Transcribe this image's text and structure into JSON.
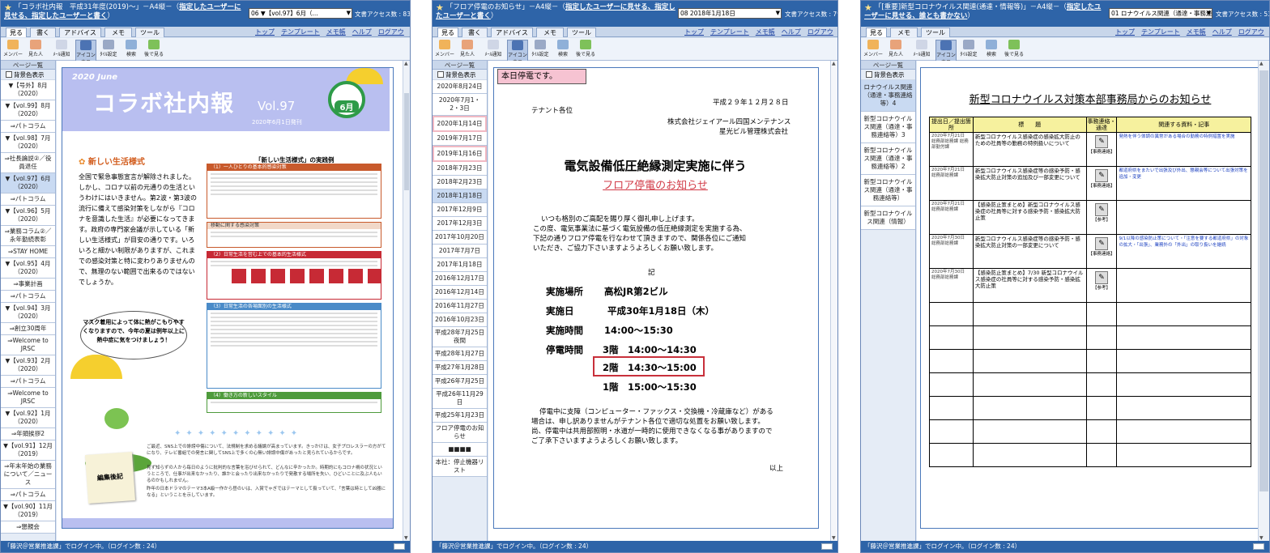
{
  "windows": [
    {
      "title": "「コラボ社内報　平成31年度(2019)～」－A4縦－（",
      "title_link": "指定したユーザーに見せる、指定したユーザーと書く",
      "title_end": "）",
      "select": "06 ▼【vol.97】6月（...",
      "access": "文書アクセス数 : 839",
      "tabs": [
        "見る",
        "書く",
        "アドバイス",
        "メモ",
        "ツール"
      ],
      "links": [
        "トップ",
        "テンプレート",
        "メモ帳",
        "ヘルプ",
        "ログアウト"
      ],
      "tools": [
        "メンバー",
        "見た人",
        "ﾒｰﾙ通知",
        "アイコン表示",
        "ﾀｲﾙ設定",
        "検索",
        "後で見る"
      ],
      "sidebar_header": "ページ一覧",
      "sidebar_check": "背景色表示",
      "sidebar_items": [
        "▼【号外】8月（2020）",
        "▼【vol.99】8月（2020）",
        "⇒パトコラム",
        "▼【vol.98】7月（2020）",
        "⇒社長論説②／役員退任",
        "▼【vol.97】6月（2020）",
        "⇒パトコラム",
        "▼【vol.96】5月（2020）",
        "⇒業務コラム②／永年勤続表彰",
        "⇒STAY HOME",
        "▼【vol.95】4月（2020）",
        "⇒事業計画",
        "⇒パトコラム",
        "▼【vol.94】3月（2020）",
        "⇒創立30周年",
        "⇒Welcome to JRSC",
        "▼【vol.93】2月（2020）",
        "⇒パトコラム",
        "⇒Welcome to JRSC",
        "▼【vol.92】1月（2020）",
        "⇒年頭挨拶2",
        "▼【vol.91】12月（2019）",
        "⇒年末年始の業務について／ニュース",
        "⇒パトコラム",
        "▼【vol.90】11月（2019）",
        "⇒懇親会"
      ],
      "newsletter": {
        "year": "2020 June",
        "title": "コラボ社内報",
        "vol": "Vol.97",
        "date": "2020年6月1日発刊",
        "month": "6月",
        "section": "新しい生活様式",
        "body": "全国で緊急事態宣言が解除されました。しかし、コロナ以前の元通りの生活というわけにはいきません。第2波・第3波の流行に備えて感染対策をしながら『コロナを意識した生活』が必要になってきます。政府の専門家会議が示している「新しい生活様式」が目安の通りです。いろいろと細かい制限がありますが、これまでの感染対策と特に変わりありませんので、無理のない範囲で出来るのではないでしょうか。",
        "right_title": "「新しい生活様式」の実践例",
        "box1": "（1）一人ひとりの基本的感染対策",
        "box2": "移動に関する感染対策",
        "box3": "（2）日常生活を営む上での基本的生活様式",
        "box4": "（3）日常生活の各場面別の生活様式",
        "box5": "（4）働き方の新しいスタイル",
        "bubble": "マスク着用によって体に熱がこもりやすくなりますので、今年の夏は例年以上に熱中症に気をつけましょう！",
        "note": "編集後記",
        "para1": "ご最近、SNS上での誹謗中傷について、法規制を求める議論が高まっています。きっかけは、女子プロレスラーの方がてになり、テレビ番組での発言に関してSNS上で多くの心無い誹謗中傷があったと見られているからです。",
        "para2": "見ず知らずの人から毎日のように批判的な言葉を浴びせられて、どんなに辛かったか。時期的にもコロナ禍の状況というところで、仕事が出来なかったり、誰かと会ったり出来なかったりで発散する場所を失い、ひどいことに及ぶ人もいるのかもしれません。",
        "para3": "昨年の日本ドラマのテーマ3本A級一作から昼のいは、入賞でゃぎではテーマとして扱っていて、「言葉は時として凶器になる」ということを示しています。"
      },
      "status": "「藤沢＠営業推進課」でログイン中。（ログイン数 : 24）"
    },
    {
      "title": "「フロア停電のお知らせ」－A4縦－（",
      "title_link": "指定したユーザーに見せる、指定したユーザーと書く",
      "title_end": "）",
      "select": "08 2018年1月18日",
      "access": "文書アクセス数 : 797",
      "tabs": [
        "見る",
        "書く",
        "アドバイス",
        "メモ",
        "ツール"
      ],
      "links": [
        "トップ",
        "テンプレート",
        "メモ帳",
        "ヘルプ",
        "ログアウト"
      ],
      "tools": [
        "メンバー",
        "見た人",
        "ﾒｰﾙ通知",
        "アイコン表示",
        "ﾀｲﾙ設定",
        "検索",
        "後で見る"
      ],
      "sidebar_header": "ページ一覧",
      "sidebar_check": "背景色表示",
      "sidebar_items": [
        "2020年8月24日",
        "2020年7月1・2・3日",
        "2020年1月14日",
        "2019年7月17日",
        "2019年1月16日",
        "2018年7月23日",
        "2018年2月23日",
        "2018年1月18日",
        "2017年12月9日",
        "2017年12月3日",
        "2017年10月20日",
        "2017年7月7日",
        "2017年1月18日",
        "2016年12月17日",
        "2016年12月14日",
        "2016年11月27日",
        "2016年10月23日",
        "平成28年7月25日夜間",
        "平成28年1月27日",
        "平成27年1月28日",
        "平成26年7月25日",
        "平成26年11月29日",
        "平成25年1月23日",
        "フロア停電のお知らせ",
        "■■■■",
        "本社：停止機器リスト"
      ],
      "notice": {
        "label": "本日停電です。",
        "to": "テナント各位",
        "date": "平成２９年１２月２８日",
        "from1": "株式会社ジェイアール四国メンテナンス",
        "from2": "星光ビル管理株式会社",
        "h1": "電気設備低圧絶縁測定実施に伴う",
        "h2": "フロア停電のお知らせ",
        "intro1": "いつも格別のご高配を賜り厚く御礼申し上げます。",
        "intro2": "この度、電気事業法に基づく電気設備の低圧絶縁測定を実施する為、",
        "intro3": "下記の通りフロア停電を行なわせて頂きますので、関係各位にご通知",
        "intro4": "いただき、ご協力下さいますようよろしくお願い致します。",
        "ki": "記",
        "place_label": "実施場所",
        "place": "高松JR第2ビル",
        "day_label": "実施日",
        "day": "平成30年1月18日（木）",
        "time_label": "実施時間",
        "time": "14:00～15:30",
        "outage_label": "停電時間",
        "outage1": "3階　14:00～14:30",
        "outage2": "2階　14:30～15:00",
        "outage3": "1階　15:00～15:30",
        "foot1": "停電中に支障（コンピューター・ファックス・交換機・冷蔵庫など）がある",
        "foot2": "場合は、申し訳ありませんがテナント各位で適切な処置をお願い致します。",
        "foot3": "尚、停電中は共用部照明・水道が一時的に使用できなくなる事がありますので",
        "foot4": "ご了承下さいますようよろしくお願い致します。",
        "end": "以上"
      },
      "status": "「藤沢＠営業推進課」でログイン中。（ログイン数 : 24）"
    },
    {
      "title": "「[重要]新型コロナウイルス関連(通達・情報等)」－A4縦－（",
      "title_link": "指定したユーザーに見せる、誰とも書かない",
      "title_end": "）",
      "select": "01 ロナウイルス関連（通達・事務連...",
      "access": "文書アクセス数 : 533",
      "tabs": [
        "見る",
        "メモ",
        "ツール"
      ],
      "links": [
        "トップ",
        "テンプレート",
        "メモ帳",
        "ヘルプ",
        "ログアウト"
      ],
      "tools": [
        "メンバー",
        "見た人",
        "ﾒｰﾙ通知",
        "アイコン表示",
        "ﾀｲﾙ設定",
        "検索",
        "後で見る"
      ],
      "sidebar_header": "ページ一覧",
      "sidebar_check": "背景色表示",
      "sidebar_items": [
        "ロナウイルス関連（通達・事務連絡等）4",
        "新型コロナウイルス関連（通達・事務連絡等）3",
        "新型コロナウイルス関連（通達・事務連絡等）2",
        "新型コロナウイルス関連（通達・事務連絡等）",
        "新型コロナウイルス関連（情報）"
      ],
      "covid": {
        "title": "新型コロナウイルス対策本部事務局からのお知らせ",
        "headers": [
          "提出日／提出箇所",
          "標　　題",
          "事務連絡・通達",
          "関連する資料・記事"
        ],
        "rows": [
          {
            "date": "2020年7月21日",
            "org": "総務部総務課 総務部勤労課",
            "subject": "新型コロナウイルス感染症の感染拡大防止のための社員等の勤務の特例扱いについて",
            "tag": "【事務連絡】",
            "related": "発熱を伴う体調の異常がある場合の勤務の特例措置を実施"
          },
          {
            "date": "2020年7月21日",
            "org": "総務部総務課",
            "subject": "新型コロナウイルス感染症等の感染予防・感染拡大防止対策の追加及び一部変更について",
            "tag": "【事務連絡】",
            "related": "都道府県をまたいで出張及び外出、懇親会等について出張対策を追加・変更"
          },
          {
            "date": "2020年7月21日",
            "org": "総務部総務課",
            "subject": "【感染防止策まとめ】新型コロナウイルス感染症の社員等に対する感染予防・感染拡大防止策",
            "tag": "【参考】",
            "related": ""
          },
          {
            "date": "2020年7月30日",
            "org": "総務部総務課",
            "subject": "新型コロナウイルス感染症等の感染予防・感染拡大防止対策の一部変更について",
            "tag": "【事務連絡】",
            "related": "9/1以降の感染防止策について・「注意を要する都道府県」の対象の拡大・「出張」、業務外の「外出」の取り扱いを継続"
          },
          {
            "date": "2020年7月30日",
            "org": "総務部総務課",
            "subject": "【感染防止策まとめ】7/30 新型コロナウイルス感染症の社員等に対する感染予防・感染拡大防止策",
            "tag": "【参考】",
            "related": ""
          }
        ]
      },
      "status": "「藤沢＠営業推進課」でログイン中。（ログイン数 : 24）"
    }
  ]
}
